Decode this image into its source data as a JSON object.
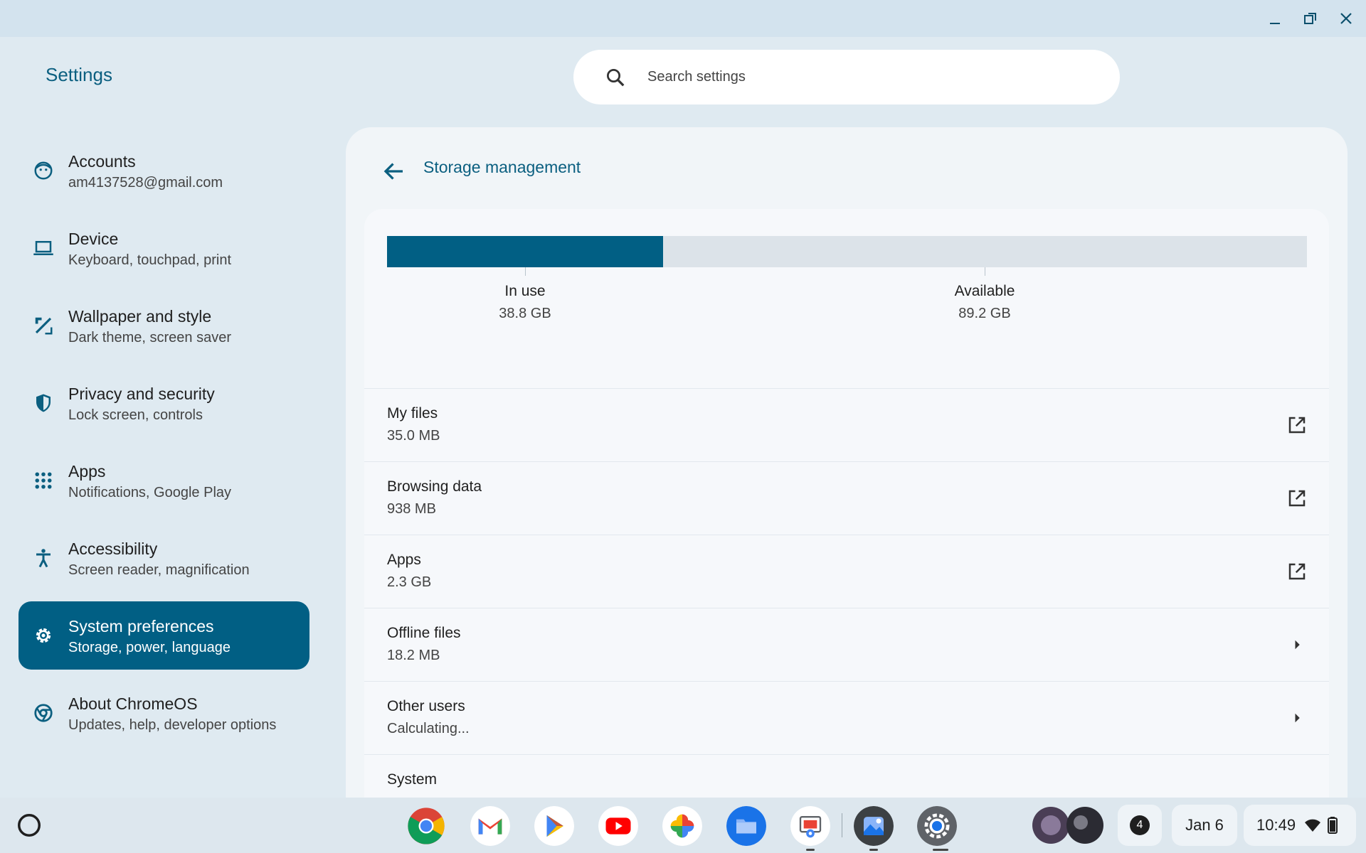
{
  "app": {
    "title": "Settings"
  },
  "search": {
    "placeholder": "Search settings"
  },
  "sidebar": {
    "items": [
      {
        "title": "Accounts",
        "subtitle": "am4137528@gmail.com",
        "icon": "account-face-icon"
      },
      {
        "title": "Device",
        "subtitle": "Keyboard, touchpad, print",
        "icon": "laptop-icon"
      },
      {
        "title": "Wallpaper and style",
        "subtitle": "Dark theme, screen saver",
        "icon": "palette-brush-icon"
      },
      {
        "title": "Privacy and security",
        "subtitle": "Lock screen, controls",
        "icon": "shield-icon"
      },
      {
        "title": "Apps",
        "subtitle": "Notifications, Google Play",
        "icon": "apps-grid-icon"
      },
      {
        "title": "Accessibility",
        "subtitle": "Screen reader, magnification",
        "icon": "accessibility-icon"
      },
      {
        "title": "System preferences",
        "subtitle": "Storage, power, language",
        "icon": "gear-icon",
        "active": true
      },
      {
        "title": "About ChromeOS",
        "subtitle": "Updates, help, developer options",
        "icon": "chromeos-icon"
      }
    ]
  },
  "main": {
    "title": "Storage management",
    "storage": {
      "in_use_label": "In use",
      "in_use_value": "38.8 GB",
      "available_label": "Available",
      "available_value": "89.2 GB",
      "used_fraction": 0.3
    },
    "rows": [
      {
        "title": "My files",
        "subtitle": "35.0 MB",
        "action": "open-in-new-icon"
      },
      {
        "title": "Browsing data",
        "subtitle": "938 MB",
        "action": "open-in-new-icon"
      },
      {
        "title": "Apps",
        "subtitle": "2.3 GB",
        "action": "open-in-new-icon"
      },
      {
        "title": "Offline files",
        "subtitle": "18.2 MB",
        "action": "chevron-right-icon"
      },
      {
        "title": "Other users",
        "subtitle": "Calculating...",
        "action": "chevron-right-icon"
      },
      {
        "title": "System",
        "subtitle": "",
        "action": ""
      }
    ]
  },
  "shelf": {
    "apps": [
      "chrome-icon",
      "gmail-icon",
      "play-store-icon",
      "youtube-icon",
      "photos-icon",
      "files-icon",
      "chrome-remote-icon",
      "gallery-icon",
      "settings-icon"
    ],
    "notification_count": "4",
    "date": "Jan 6",
    "time": "10:49"
  }
}
